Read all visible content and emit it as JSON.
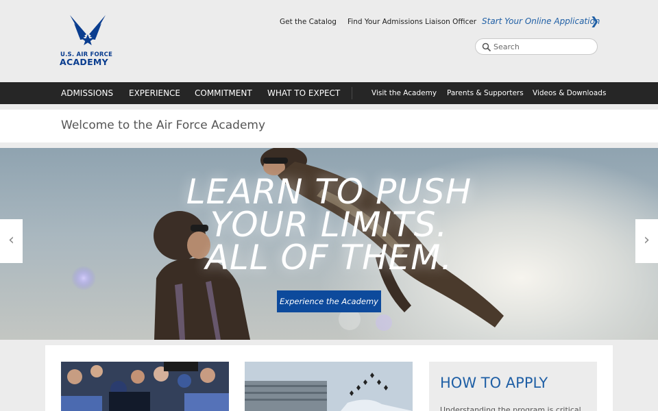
{
  "logo": {
    "line1": "U.S. AIR FORCE",
    "line2": "ACADEMY"
  },
  "top_links": {
    "catalog": "Get the Catalog",
    "liaison": "Find Your Admissions Liaison Officer",
    "apply": "Start Your Online Application",
    "apply_chevron": "❯"
  },
  "search": {
    "placeholder": "Search",
    "value": ""
  },
  "nav": {
    "major": [
      "ADMISSIONS",
      "EXPERIENCE",
      "COMMITMENT",
      "WHAT TO EXPECT"
    ],
    "minor": [
      "Visit the Academy",
      "Parents & Supporters",
      "Videos & Downloads"
    ]
  },
  "welcome": {
    "title": "Welcome to the Air Force Academy"
  },
  "hero": {
    "headline": [
      "LEARN TO PUSH",
      "YOUR LIMITS.",
      "ALL OF THEM."
    ],
    "cta": "Experience the Academy",
    "prev": "‹",
    "next": "›"
  },
  "cards": {
    "apply_title": "HOW TO APPLY",
    "apply_text": "Understanding the program is critical"
  },
  "colors": {
    "brand_blue": "#0a3d8f",
    "link_blue": "#1f5fa5",
    "nav_bg": "#262626",
    "button_blue": "#0d4a9c"
  },
  "icons": [
    "air-force-logo-icon",
    "search-icon",
    "chevron-right-icon",
    "arrow-left-icon",
    "arrow-right-icon"
  ]
}
